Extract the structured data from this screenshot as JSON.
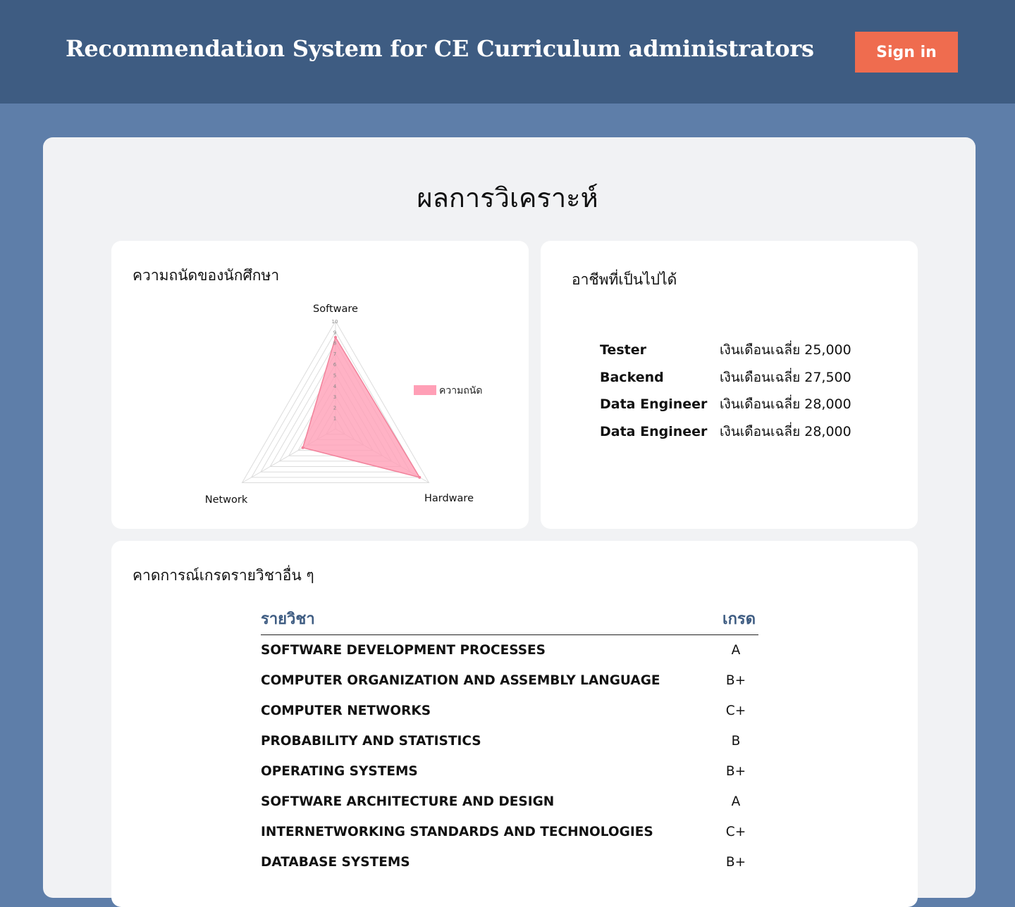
{
  "header": {
    "title": "Recommendation System for CE Curriculum administrators",
    "signin_label": "Sign in",
    "colors": {
      "bar": "#3e5c82",
      "button": "#ef6c4f",
      "page_bg": "#5e7ea9"
    }
  },
  "page_title": "ผลการวิเคราะห์",
  "aptitude_card": {
    "title": "ความถนัดของนักศึกษา"
  },
  "careers_card": {
    "title": "อาชีพที่เป็นไปได้",
    "items": [
      {
        "name": "Tester",
        "salary": "เงินเดือนเฉลี่ย 25,000"
      },
      {
        "name": "Backend",
        "salary": "เงินเดือนเฉลี่ย 27,500"
      },
      {
        "name": "Data Engineer",
        "salary": "เงินเดือนเฉลี่ย 28,000"
      },
      {
        "name": "Data Engineer",
        "salary": "เงินเดือนเฉลี่ย 28,000"
      }
    ]
  },
  "grades_card": {
    "title": "คาดการณ์เกรดรายวิชาอื่น ๆ",
    "col_course": "รายวิชา",
    "col_grade": "เกรด",
    "rows": [
      {
        "course": "SOFTWARE DEVELOPMENT PROCESSES",
        "grade": "A"
      },
      {
        "course": "COMPUTER ORGANIZATION AND ASSEMBLY LANGUAGE",
        "grade": "B+"
      },
      {
        "course": "COMPUTER NETWORKS",
        "grade": "C+"
      },
      {
        "course": "PROBABILITY AND STATISTICS",
        "grade": "B"
      },
      {
        "course": "OPERATING SYSTEMS",
        "grade": "B+"
      },
      {
        "course": "SOFTWARE ARCHITECTURE AND DESIGN",
        "grade": "A"
      },
      {
        "course": "INTERNETWORKING STANDARDS AND TECHNOLOGIES",
        "grade": "C+"
      },
      {
        "course": "DATABASE SYSTEMS",
        "grade": "B+"
      }
    ]
  },
  "chart_data": {
    "type": "radar",
    "categories": [
      "Software",
      "Hardware",
      "Network"
    ],
    "series": [
      {
        "name": "ความถนัด",
        "values": [
          8.5,
          9,
          3.5
        ],
        "color": "#ff9fb6"
      }
    ],
    "rlim": [
      0,
      10
    ],
    "ticks": [
      "1",
      "2",
      "3",
      "4",
      "5",
      "6",
      "7",
      "8",
      "9",
      "10"
    ],
    "legend": "right"
  }
}
